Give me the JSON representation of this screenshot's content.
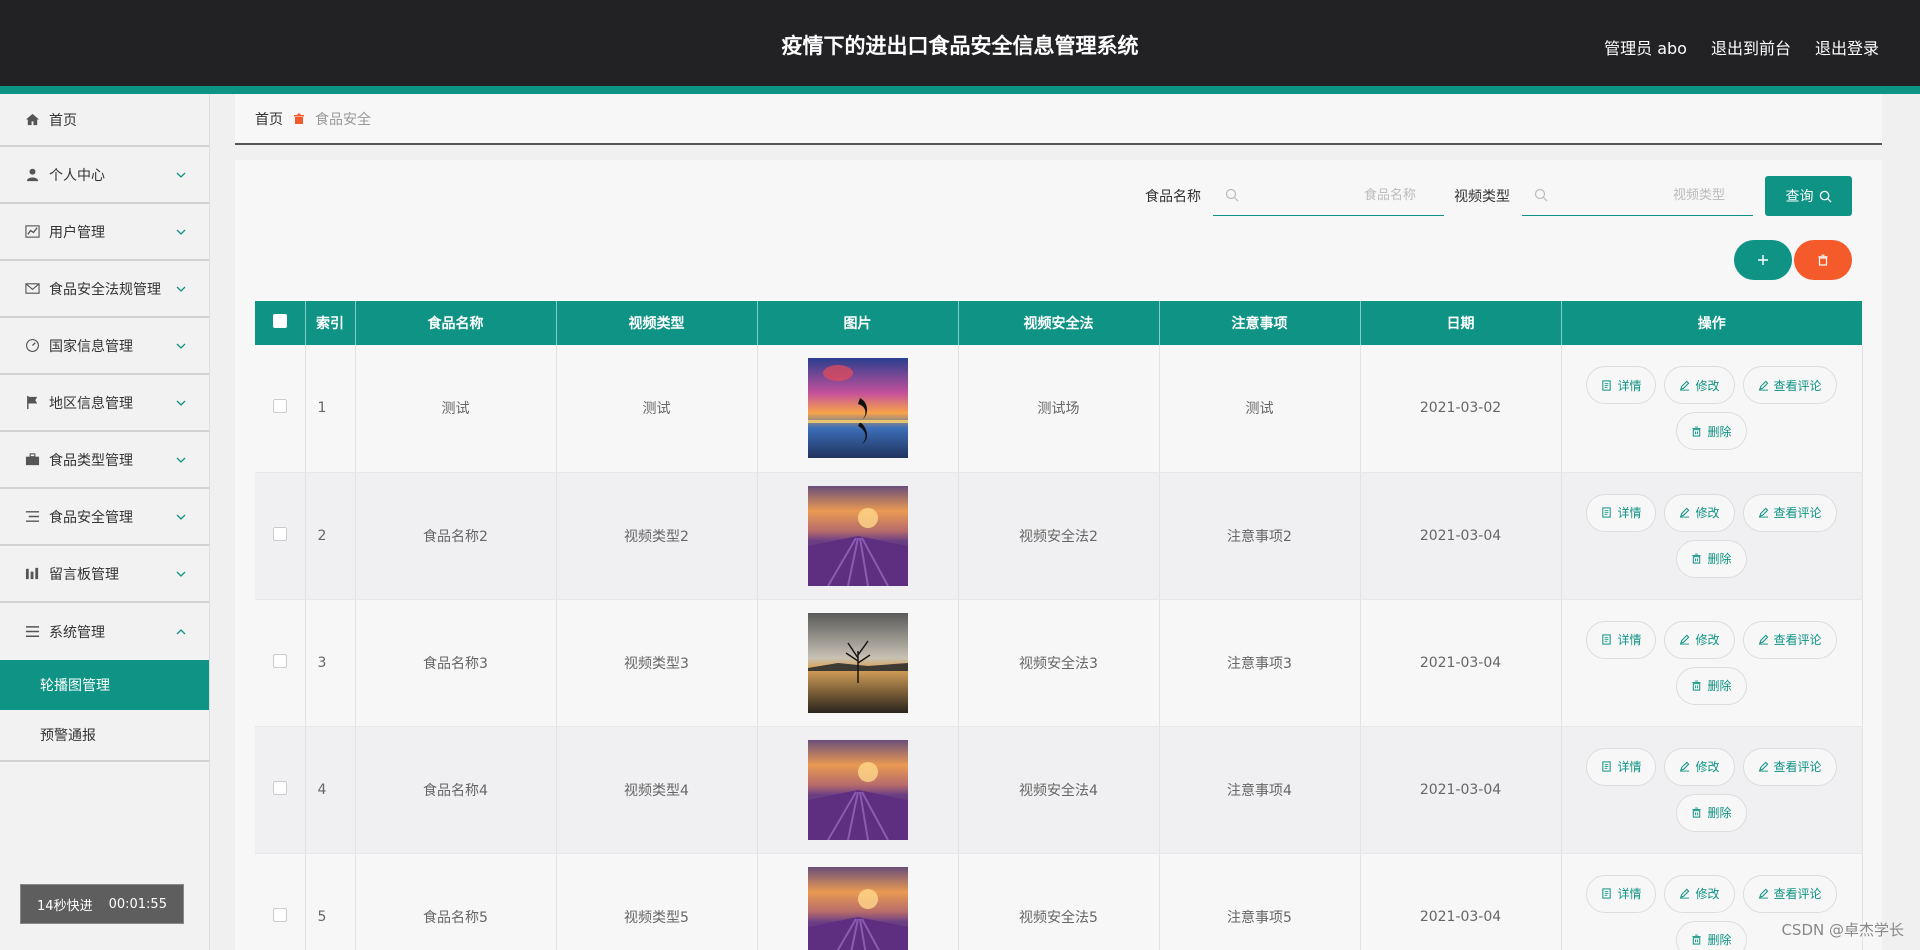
{
  "header": {
    "title": "疫情下的进出口食品安全信息管理系统",
    "links": [
      "管理员 abo",
      "退出到前台",
      "退出登录"
    ]
  },
  "sidebar": {
    "items": [
      {
        "label": "首页",
        "icon": "home-icon",
        "expandable": false
      },
      {
        "label": "个人中心",
        "icon": "user-icon",
        "expandable": true
      },
      {
        "label": "用户管理",
        "icon": "chart-icon",
        "expandable": true
      },
      {
        "label": "食品安全法规管理",
        "icon": "mail-icon",
        "expandable": true
      },
      {
        "label": "国家信息管理",
        "icon": "gauge-icon",
        "expandable": true
      },
      {
        "label": "地区信息管理",
        "icon": "flag-icon",
        "expandable": true
      },
      {
        "label": "食品类型管理",
        "icon": "briefcase-icon",
        "expandable": true
      },
      {
        "label": "食品安全管理",
        "icon": "list-icon",
        "expandable": true
      },
      {
        "label": "留言板管理",
        "icon": "bars-icon",
        "expandable": true
      },
      {
        "label": "系统管理",
        "icon": "menu-icon",
        "expandable": true,
        "expanded": true
      }
    ],
    "sub_items": [
      {
        "label": "轮播图管理",
        "active": true
      },
      {
        "label": "预警通报",
        "active": false
      }
    ],
    "timer": {
      "label": "14秒快进",
      "time": "00:01:55"
    }
  },
  "breadcrumb": {
    "home": "首页",
    "current": "食品安全"
  },
  "search": {
    "food_name_label": "食品名称",
    "food_name_placeholder": "食品名称",
    "video_type_label": "视频类型",
    "video_type_placeholder": "视频类型",
    "query_label": "查询"
  },
  "table": {
    "headers": [
      "索引",
      "食品名称",
      "视频类型",
      "图片",
      "视频安全法",
      "注意事项",
      "日期",
      "操作"
    ],
    "rows": [
      {
        "index": "1",
        "name": "测试",
        "type": "测试",
        "image": "sunset-dolphin",
        "law": "测试场",
        "notice": "测试",
        "date": "2021-03-02"
      },
      {
        "index": "2",
        "name": "食品名称2",
        "type": "视频类型2",
        "image": "lavender-field",
        "law": "视频安全法2",
        "notice": "注意事项2",
        "date": "2021-03-04"
      },
      {
        "index": "3",
        "name": "食品名称3",
        "type": "视频类型3",
        "image": "lake-tree",
        "law": "视频安全法3",
        "notice": "注意事项3",
        "date": "2021-03-04"
      },
      {
        "index": "4",
        "name": "食品名称4",
        "type": "视频类型4",
        "image": "lavender-field",
        "law": "视频安全法4",
        "notice": "注意事项4",
        "date": "2021-03-04"
      },
      {
        "index": "5",
        "name": "食品名称5",
        "type": "视频类型5",
        "image": "lavender-field",
        "law": "视频安全法5",
        "notice": "注意事项5",
        "date": "2021-03-04"
      }
    ],
    "ops": {
      "detail": "详情",
      "edit": "修改",
      "comments": "查看评论",
      "delete": "删除"
    }
  },
  "watermark": "CSDN @卓杰学长",
  "colors": {
    "accent": "#0e9384",
    "danger": "#f45a2a",
    "header_bg": "#222224"
  }
}
